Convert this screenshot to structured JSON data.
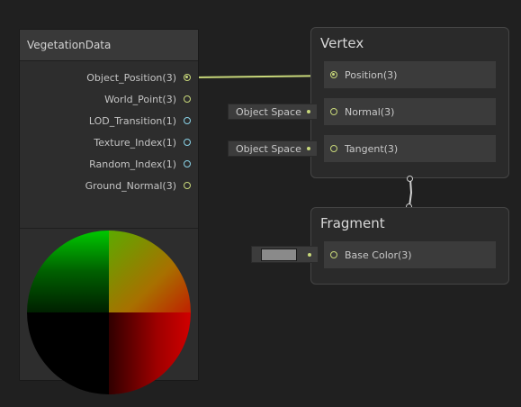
{
  "data_node": {
    "title": "VegetationData",
    "ports": [
      {
        "label": "Object_Position(3)",
        "color": "#c8d87a",
        "connected": true
      },
      {
        "label": "World_Point(3)",
        "color": "#c8d87a",
        "connected": false
      },
      {
        "label": "LOD_Transition(1)",
        "color": "#8ad3e8",
        "connected": false
      },
      {
        "label": "Texture_Index(1)",
        "color": "#8ad3e8",
        "connected": false
      },
      {
        "label": "Random_Index(1)",
        "color": "#8ad3e8",
        "connected": false
      },
      {
        "label": "Ground_Normal(3)",
        "color": "#c8d87a",
        "connected": false
      }
    ]
  },
  "vertex": {
    "title": "Vertex",
    "blocks": [
      {
        "label": "Position(3)"
      },
      {
        "label": "Normal(3)",
        "input": "Object Space"
      },
      {
        "label": "Tangent(3)",
        "input": "Object Space"
      }
    ]
  },
  "fragment": {
    "title": "Fragment",
    "blocks": [
      {
        "label": "Base Color(3)",
        "swatch_color": "#8a8a8a"
      }
    ]
  },
  "colors": {
    "vector3_port": "#c8d87a",
    "float_port": "#8ad3e8",
    "background": "#202020"
  }
}
